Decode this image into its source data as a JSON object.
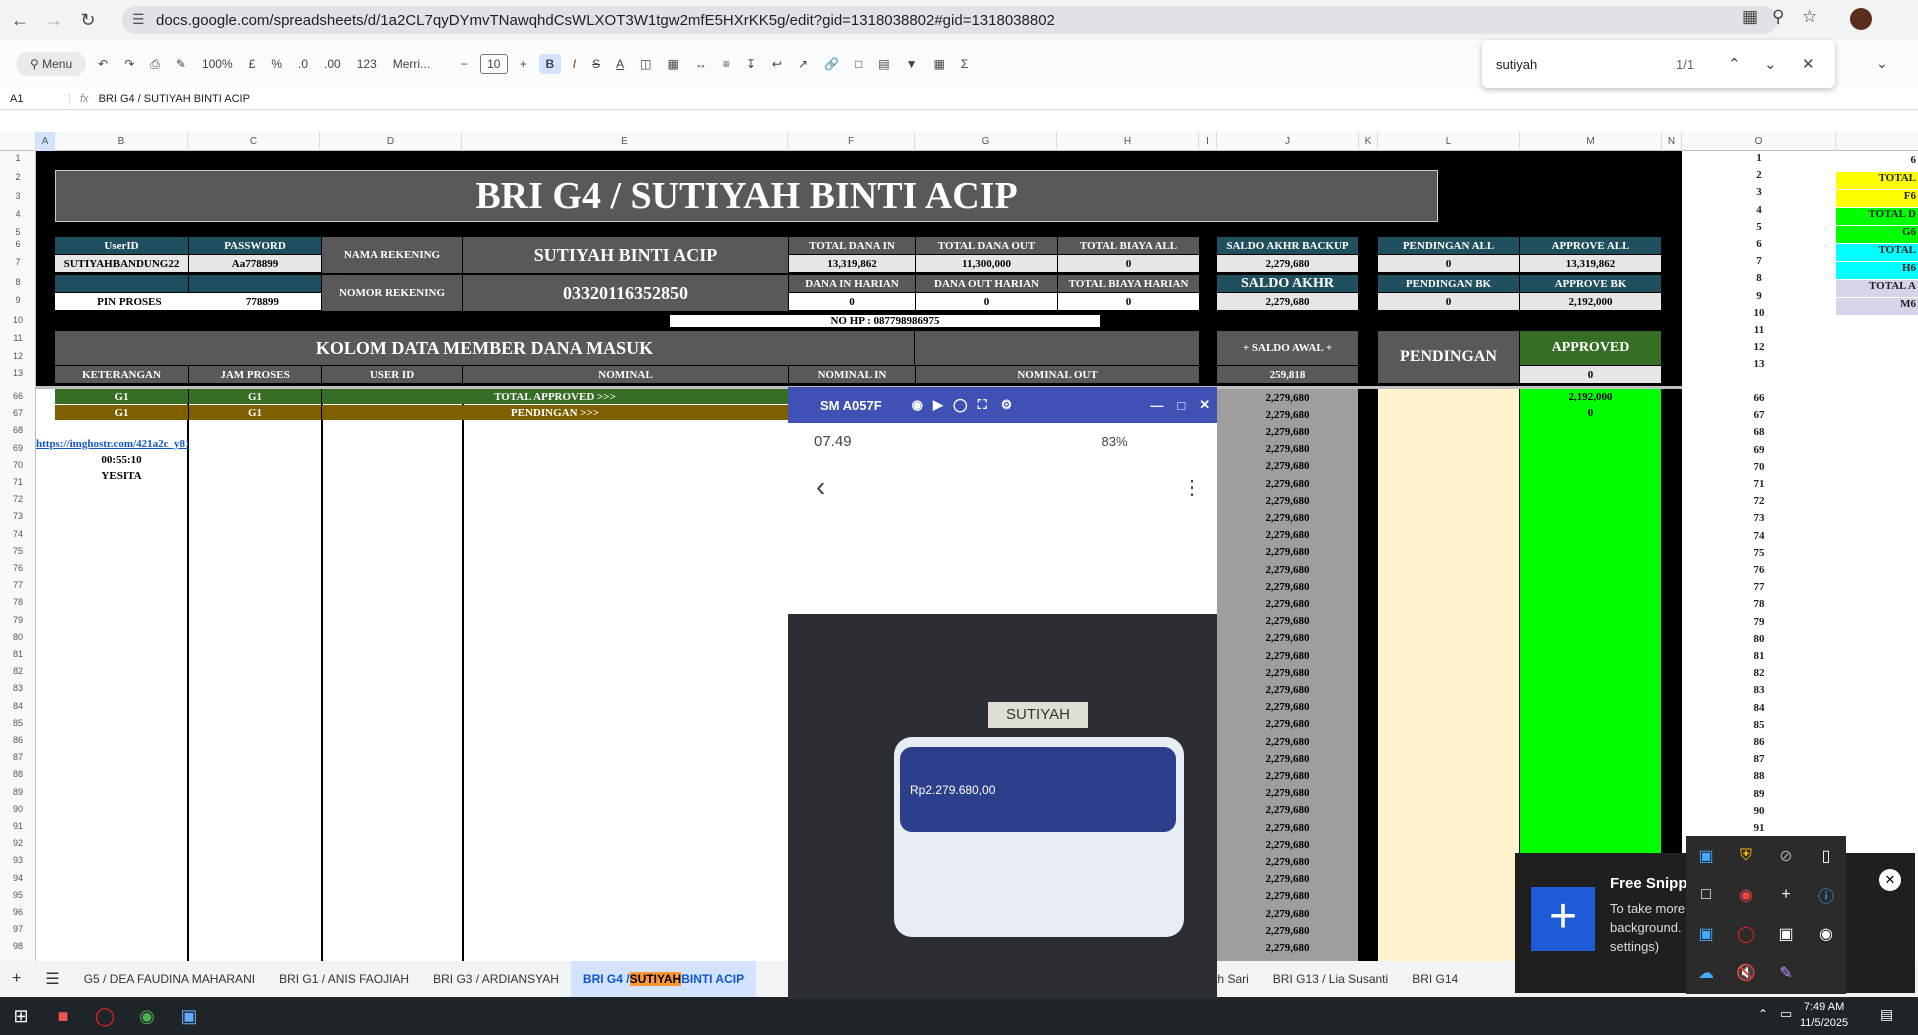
{
  "browser": {
    "url": "docs.google.com/spreadsheets/d/1a2CL7qyDYmvTNawqhdCsWLXOT3W1tgw2mfE5HXrKK5g/edit?gid=1318038802#gid=1318038802"
  },
  "toolbar": {
    "menu": "Menu",
    "zoom": "100%",
    "currency": "£",
    "percent": "%",
    "dec_minus": ".0",
    "dec_plus": ".00",
    "numfmt": "123",
    "font": "Merri...",
    "font_size": "10"
  },
  "find": {
    "query": "sutiyah",
    "count": "1/1"
  },
  "formula": {
    "cell": "A1",
    "content": "BRI G4 / SUTIYAH BINTI ACIP"
  },
  "columns": [
    "A",
    "B",
    "C",
    "D",
    "E",
    "F",
    "G",
    "H",
    "I",
    "J",
    "K",
    "L",
    "M",
    "N",
    "O"
  ],
  "rows_top": [
    "1",
    "2",
    "3",
    "4",
    "5",
    "6",
    "7",
    "8",
    "9",
    "10",
    "11",
    "12",
    "13"
  ],
  "rows_body": [
    "66",
    "67",
    "68",
    "69",
    "70",
    "71",
    "72",
    "73",
    "74",
    "75",
    "76",
    "77",
    "78",
    "79",
    "80",
    "81",
    "82",
    "83",
    "84",
    "85",
    "86",
    "87",
    "88",
    "89",
    "90",
    "91",
    "92",
    "93",
    "94",
    "95",
    "96",
    "97",
    "98"
  ],
  "sheet": {
    "title": "BRI G4 / SUTIYAH BINTI ACIP",
    "userid_label": "UserID",
    "password_label": "PASSWORD",
    "userid": "SUTIYAHBANDUNG22",
    "password": "Aa778899",
    "pin_label": "PIN PROSES",
    "pin": "778899",
    "nama_rek_label": "NAMA REKENING",
    "nama_rek": "SUTIYAH BINTI ACIP",
    "nomor_rek_label": "NOMOR REKENING",
    "nomor_rek": "03320116352850",
    "nohp": "NO HP : 087798986975",
    "tdi_label": "TOTAL DANA IN",
    "tdi": "13,319,862",
    "tdo_label": "TOTAL DANA OUT",
    "tdo": "11,300,000",
    "tba_label": "TOTAL BIAYA ALL",
    "tba": "0",
    "dih_label": "DANA IN HARIAN",
    "dih": "0",
    "doh_label": "DANA OUT HARIAN",
    "doh": "0",
    "tbh_label": "TOTAL BIAYA HARIAN",
    "tbh": "0",
    "sab_label": "SALDO AKHR BACKUP",
    "sab": "2,279,680",
    "sa_label": "SALDO AKHR",
    "sa": "2,279,680",
    "pall_label": "PENDINGAN ALL",
    "pall": "0",
    "aall_label": "APPROVE ALL",
    "aall": "13,319,862",
    "pbk_label": "PENDINGAN BK",
    "pbk": "0",
    "abk_label": "APPROVE BK",
    "abk": "2,192,000",
    "kolom": "KOLOM DATA MEMBER DANA MASUK",
    "saldo_awal_label": "+ SALDO AWAL +",
    "saldo_awal": "259,818",
    "pendingan": "PENDINGAN",
    "approved": "APPROVED",
    "approved_val": "0",
    "h_ket": "KETERANGAN",
    "h_jam": "JAM PROSES",
    "h_uid": "USER ID",
    "h_nom": "NOMINAL",
    "h_nin": "NOMINAL IN",
    "h_nout": "NOMINAL OUT",
    "g1": "G1",
    "total_approved": "TOTAL APPROVED >>>",
    "pendingan_row": "PENDINGAN >>>",
    "m66": "2,192,000",
    "m67": "0",
    "link": "https://imghostr.com/421a2c_y81",
    "time": "00:55:10",
    "name": "YESITA",
    "saldo_rows": "2,279,680"
  },
  "o_nums": [
    "1",
    "2",
    "3",
    "4",
    "5",
    "6",
    "7",
    "8",
    "9",
    "10",
    "11",
    "12",
    "13",
    "66",
    "67",
    "68",
    "69",
    "70",
    "71",
    "72",
    "73",
    "74",
    "75",
    "76",
    "77",
    "78",
    "79",
    "80",
    "81",
    "82",
    "83",
    "84",
    "85",
    "86",
    "87",
    "88",
    "89",
    "90",
    "91",
    "92"
  ],
  "p_labels": [
    "6",
    "TOTAL",
    "F6",
    "TOTAL D",
    "G6",
    "TOTAL",
    "H6",
    "TOTAL A",
    "M6"
  ],
  "phone": {
    "title": "SM A057F",
    "time": "07.49",
    "battery": "83%",
    "balance": "Rp2.279.680,00",
    "sticker": "SUTIYAH"
  },
  "tabs": [
    "G5 / DEA FAUDINA MAHARANI",
    "BRI G1 / ANIS FAOJIAH",
    "BRI G3 / ARDIANSYAH",
    "BRI G4 / ",
    "SUTIYAH",
    " BINTI ACIP",
    "i Indah Sari",
    "BRI G13 / Lia Susanti",
    "BRI G14"
  ],
  "snip": {
    "title": "Free Snipp",
    "body1": "To take more",
    "body2": "background.",
    "body3": "settings)"
  },
  "clock": {
    "time": "7:49 AM",
    "date": "11/5/2025"
  },
  "colors": {
    "accent": "#0b57d0",
    "approved_green": "#00ff00",
    "header_grey": "#595959"
  }
}
